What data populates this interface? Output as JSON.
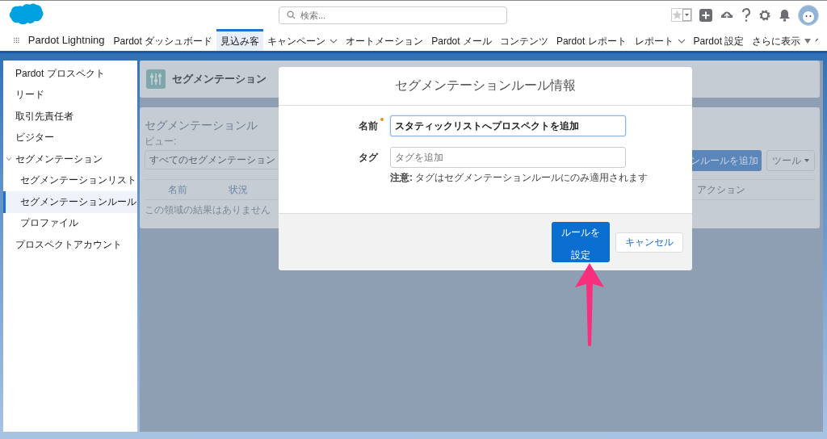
{
  "app": {
    "name": "Pardot Lightning"
  },
  "search": {
    "placeholder": "検索..."
  },
  "nav": [
    {
      "label": "Pardot ダッシュボード",
      "selected": false,
      "dropdown": false
    },
    {
      "label": "見込み客",
      "selected": true,
      "dropdown": false
    },
    {
      "label": "キャンペーン",
      "selected": false,
      "dropdown": true
    },
    {
      "label": "オートメーション",
      "selected": false,
      "dropdown": false
    },
    {
      "label": "Pardot メール",
      "selected": false,
      "dropdown": false
    },
    {
      "label": "コンテンツ",
      "selected": false,
      "dropdown": false
    },
    {
      "label": "Pardot レポート",
      "selected": false,
      "dropdown": false
    },
    {
      "label": "レポート",
      "selected": false,
      "dropdown": true
    },
    {
      "label": "Pardot 設定",
      "selected": false,
      "dropdown": false
    }
  ],
  "more_menu": {
    "label": "さらに表示"
  },
  "sidebar": [
    {
      "label": "Pardot プロスペクト",
      "selected": false
    },
    {
      "label": "リード",
      "selected": false
    },
    {
      "label": "取引先責任者",
      "selected": false
    },
    {
      "label": "ビジター",
      "selected": false
    },
    {
      "label": "セグメンテーション",
      "selected": false,
      "expanded": true,
      "children": [
        {
          "label": "セグメンテーションリスト",
          "selected": false
        },
        {
          "label": "セグメンテーションルール",
          "selected": true
        },
        {
          "label": "プロファイル",
          "selected": false
        }
      ]
    },
    {
      "label": "プロスペクトアカウント",
      "selected": false
    }
  ],
  "page_header": {
    "title": "セグメンテーション"
  },
  "list": {
    "title": "セグメンテーションル",
    "view_label": "ビュー:",
    "view_value": "すべてのセグメンテーション",
    "add_button": "ンルールを追加",
    "tools_button": "ツール",
    "columns": [
      "名前",
      "状況",
      "アクション"
    ],
    "empty_message": "この領域の結果はありません"
  },
  "modal": {
    "title": "セグメンテーションルール情報",
    "fields": [
      {
        "label": "名前",
        "required": true,
        "value": "スタティックリストへプロスペクトを追加",
        "focused": true
      },
      {
        "label": "タグ",
        "required": false,
        "placeholder": "タグを追加",
        "focused": false,
        "note": "**注意:** タグはセグメンテーションルールにのみ適用されます"
      }
    ],
    "buttons": [
      {
        "label": "ルールを設定",
        "kind": "primary"
      },
      {
        "label": "キャンセル",
        "kind": "neutral"
      }
    ]
  }
}
